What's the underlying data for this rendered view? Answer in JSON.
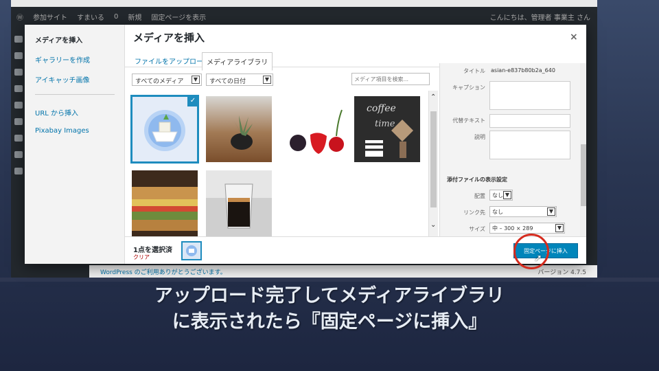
{
  "admin_bar": {
    "site": "参加サイト",
    "home": "すまいる",
    "comments": "0",
    "new": "新規",
    "view": "固定ページを表示",
    "greeting": "こんにちは、管理者 事業主 さん"
  },
  "modal": {
    "title": "メディアを挿入",
    "close": "×",
    "menu": {
      "items": [
        "メディアを挿入",
        "ギャラリーを作成",
        "アイキャッチ画像"
      ],
      "items2": [
        "URL から挿入",
        "Pixabay Images"
      ]
    },
    "tabs": [
      "ファイルをアップロード",
      "メディアライブラリ"
    ],
    "filters": {
      "type": "すべてのメディア",
      "date": "すべての日付",
      "search_placeholder": "メディア項目を検索..."
    },
    "attachment": {
      "title_label": "タイトル",
      "title_value": "asian-e837b80b2a_640",
      "caption_label": "キャプション",
      "alt_label": "代替テキスト",
      "desc_label": "説明",
      "display_heading": "添付ファイルの表示設定",
      "align_label": "配置",
      "align_value": "なし",
      "link_label": "リンク先",
      "link_value": "なし",
      "size_label": "サイズ",
      "size_value": "中 – 300 × 289"
    },
    "footer": {
      "selected_count": "1点を選択済",
      "clear": "クリア",
      "insert_button": "固定ページに挿入"
    }
  },
  "wp_footer": {
    "left": "WordPress のご利用ありがとうございます。",
    "right": "バージョン 4.7.5"
  },
  "caption": {
    "line1": "アップロード完了してメディアライブラリ",
    "line2": "に表示されたら『固定ページに挿入』"
  },
  "colors": {
    "accent": "#0085ba",
    "highlight_ring": "#d52b1e",
    "caption_text": "#e7edf5"
  }
}
